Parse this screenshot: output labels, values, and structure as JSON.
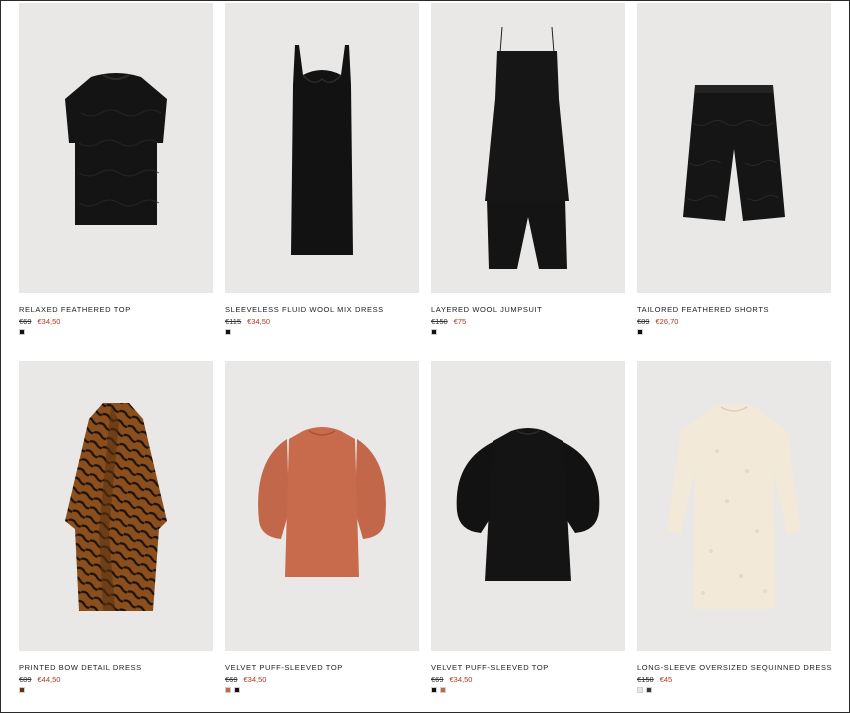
{
  "products": [
    {
      "name": "RELAXED FEATHERED TOP",
      "old_price": "€69",
      "sale_price": "€34,50",
      "swatches": [
        "#111111"
      ]
    },
    {
      "name": "SLEEVELESS FLUID WOOL MIX DRESS",
      "old_price": "€115",
      "sale_price": "€34,50",
      "swatches": [
        "#111111"
      ]
    },
    {
      "name": "LAYERED WOOL JUMPSUIT",
      "old_price": "€150",
      "sale_price": "€75",
      "swatches": [
        "#111111"
      ]
    },
    {
      "name": "TAILORED FEATHERED SHORTS",
      "old_price": "€89",
      "sale_price": "€26,70",
      "swatches": [
        "#111111"
      ]
    },
    {
      "name": "PRINTED BOW DETAIL DRESS",
      "old_price": "€89",
      "sale_price": "€44,50",
      "swatches": [
        "#5a3416"
      ]
    },
    {
      "name": "VELVET PUFF-SLEEVED TOP",
      "old_price": "€69",
      "sale_price": "€34,50",
      "swatches": [
        "#c4654a",
        "#111111"
      ]
    },
    {
      "name": "VELVET PUFF-SLEEVED TOP",
      "old_price": "€69",
      "sale_price": "€34,50",
      "swatches": [
        "#111111",
        "#c4654a"
      ]
    },
    {
      "name": "LONG-SLEEVE OVERSIZED SEQUINNED DRESS",
      "old_price": "€150",
      "sale_price": "€45",
      "swatches": [
        "#efe6d6",
        "#3a3a3a"
      ]
    }
  ],
  "colors": {
    "photo_bg": "#e9e8e6",
    "sale": "#b03a1c"
  }
}
